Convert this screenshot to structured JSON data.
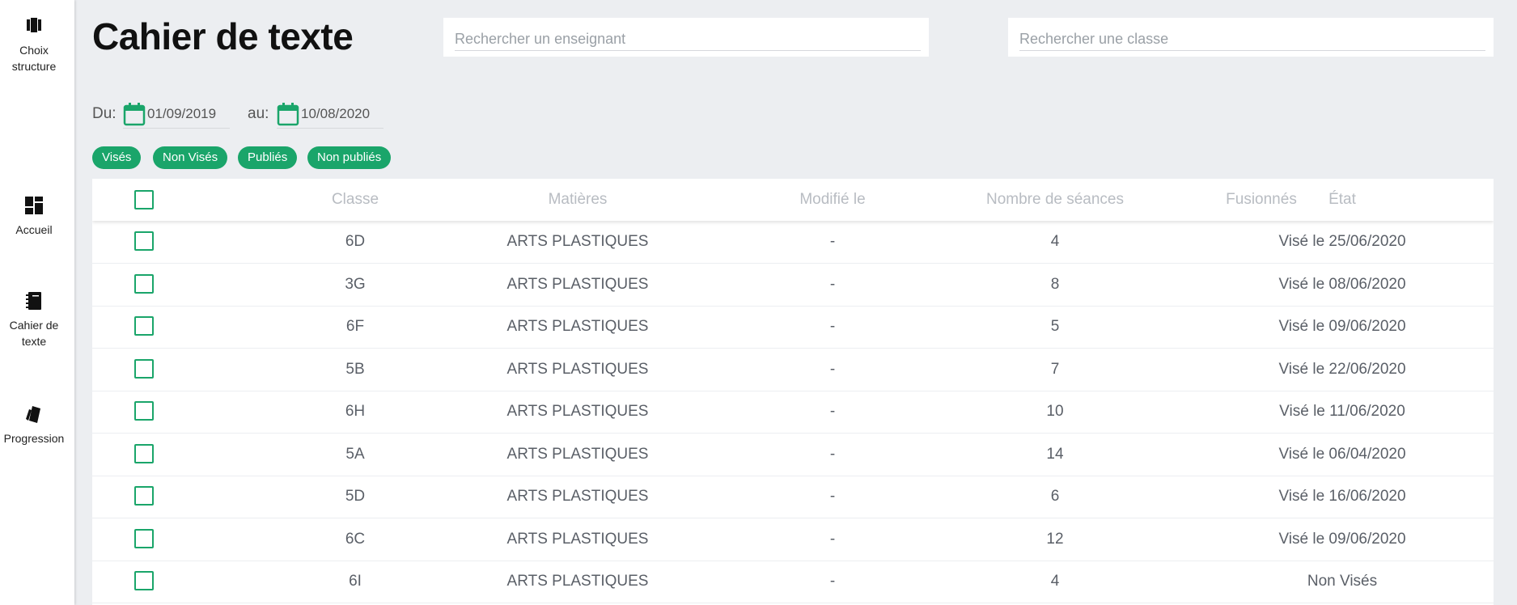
{
  "sidebar": {
    "items": [
      {
        "label_line1": "Choix",
        "label_line2": "structure",
        "icon": "structure-icon"
      },
      {
        "label_line1": "Accueil",
        "label_line2": "",
        "icon": "dashboard-icon"
      },
      {
        "label_line1": "Cahier de",
        "label_line2": "texte",
        "icon": "notebook-icon"
      },
      {
        "label_line1": "Progression",
        "label_line2": "",
        "icon": "cards-icon"
      }
    ]
  },
  "header": {
    "title": "Cahier de texte",
    "search_teacher_placeholder": "Rechercher un enseignant",
    "search_class_placeholder": "Rechercher une classe"
  },
  "dates": {
    "from_label": "Du:",
    "from_value": "01/09/2019",
    "to_label": "au:",
    "to_value": "10/08/2020"
  },
  "filters": [
    "Visés",
    "Non Visés",
    "Publiés",
    "Non publiés"
  ],
  "table": {
    "headers": {
      "classe": "Classe",
      "matieres": "Matières",
      "modifie": "Modifié le",
      "seances": "Nombre de séances",
      "fusionnes": "Fusionnés",
      "etat": "État"
    },
    "rows": [
      {
        "classe": "6D",
        "matiere": "ARTS PLASTIQUES",
        "modifie": "-",
        "seances": "4",
        "fusionnes": "",
        "etat": "Visé le 25/06/2020"
      },
      {
        "classe": "3G",
        "matiere": "ARTS PLASTIQUES",
        "modifie": "-",
        "seances": "8",
        "fusionnes": "",
        "etat": "Visé le 08/06/2020"
      },
      {
        "classe": "6F",
        "matiere": "ARTS PLASTIQUES",
        "modifie": "-",
        "seances": "5",
        "fusionnes": "",
        "etat": "Visé le 09/06/2020"
      },
      {
        "classe": "5B",
        "matiere": "ARTS PLASTIQUES",
        "modifie": "-",
        "seances": "7",
        "fusionnes": "",
        "etat": "Visé le 22/06/2020"
      },
      {
        "classe": "6H",
        "matiere": "ARTS PLASTIQUES",
        "modifie": "-",
        "seances": "10",
        "fusionnes": "",
        "etat": "Visé le 11/06/2020"
      },
      {
        "classe": "5A",
        "matiere": "ARTS PLASTIQUES",
        "modifie": "-",
        "seances": "14",
        "fusionnes": "",
        "etat": "Visé le 06/04/2020"
      },
      {
        "classe": "5D",
        "matiere": "ARTS PLASTIQUES",
        "modifie": "-",
        "seances": "6",
        "fusionnes": "",
        "etat": "Visé le 16/06/2020"
      },
      {
        "classe": "6C",
        "matiere": "ARTS PLASTIQUES",
        "modifie": "-",
        "seances": "12",
        "fusionnes": "",
        "etat": "Visé le 09/06/2020"
      },
      {
        "classe": "6I",
        "matiere": "ARTS PLASTIQUES",
        "modifie": "-",
        "seances": "4",
        "fusionnes": "",
        "etat": "Non Visés"
      }
    ]
  },
  "colors": {
    "accent": "#1aa56a",
    "background": "#eceef1"
  }
}
